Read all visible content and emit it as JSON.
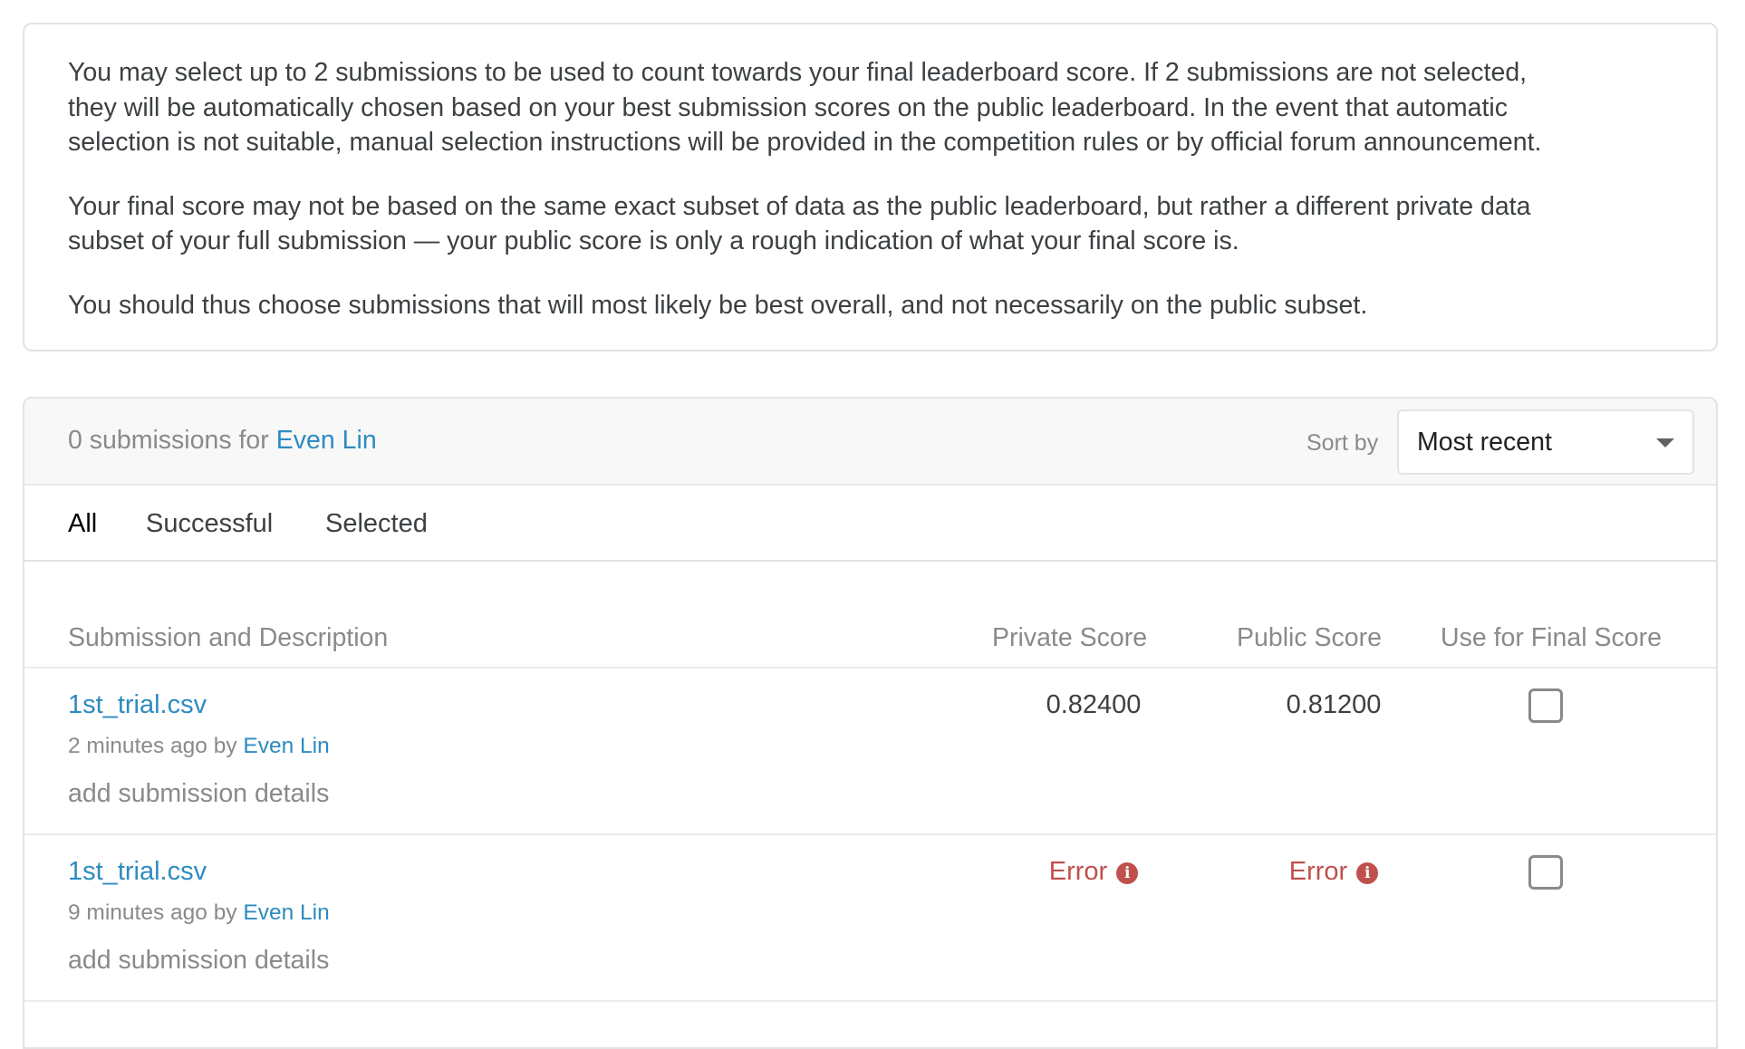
{
  "info": {
    "paragraphs": [
      [
        "You may select up to 2 submissions to be used to count towards your final leaderboard score. If 2 submissions are not selected,",
        "they will be automatically chosen based on your best submission scores on the public leaderboard. In the event that automatic",
        "selection is not suitable, manual selection instructions will be provided in the competition rules or by official forum announcement."
      ],
      [
        "Your final score may not be based on the same exact subset of data as the public leaderboard, but rather a different private data",
        "subset of your full submission — your public score is only a rough indication of what your final score is."
      ],
      [
        "You should thus choose submissions that will most likely be best overall, and not necessarily on the public subset."
      ]
    ]
  },
  "submissions_header": {
    "count_text": "0 submissions for",
    "user_name": "Even Lin",
    "sort_label": "Sort by",
    "sort_value": "Most recent"
  },
  "tabs": [
    "All",
    "Successful",
    "Selected"
  ],
  "active_tab": "All",
  "columns": {
    "submission": "Submission and Description",
    "private": "Private Score",
    "public": "Public Score",
    "final": "Use for Final Score"
  },
  "rows": [
    {
      "file": "1st_trial.csv",
      "time": "2 minutes ago by",
      "user": "Even Lin",
      "details": "add submission details",
      "private_score": "0.82400",
      "public_score": "0.81200",
      "error": false,
      "selected": false
    },
    {
      "file": "1st_trial.csv",
      "time": "9 minutes ago by",
      "user": "Even Lin",
      "details": "add submission details",
      "private_score": "Error",
      "public_score": "Error",
      "error": true,
      "selected": false
    }
  ],
  "icons": {
    "error_info": "info-icon",
    "sort_caret": "caret-down-icon"
  },
  "colors": {
    "link": "#2e8bc0",
    "error": "#c0504d",
    "muted": "#8a8a8a"
  }
}
